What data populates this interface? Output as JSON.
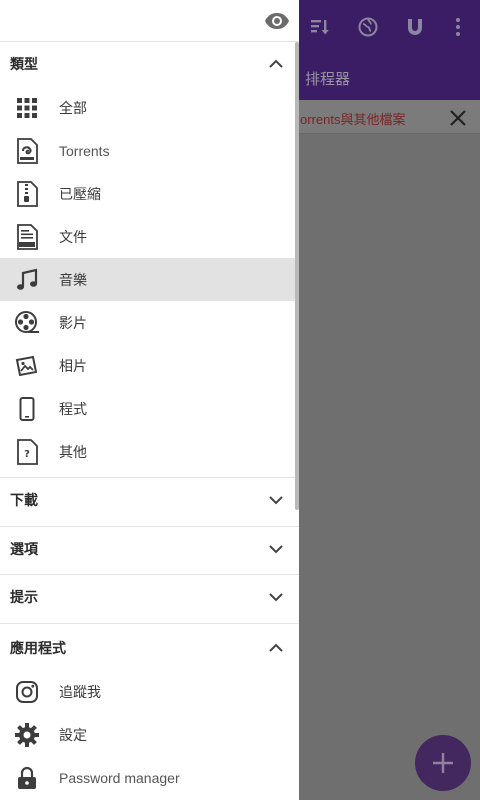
{
  "background_app": {
    "subtitle": "排程器",
    "notice_text": "orrents與其他檔案",
    "colors": {
      "app_bar": "#3a1d64",
      "notice_text": "#7d2323"
    }
  },
  "drawer": {
    "sections": {
      "types": {
        "title": "類型",
        "expanded": true
      },
      "download": {
        "title": "下載",
        "expanded": false
      },
      "options": {
        "title": "選項",
        "expanded": false
      },
      "tips": {
        "title": "提示",
        "expanded": false
      },
      "app": {
        "title": "應用程式",
        "expanded": true
      }
    },
    "type_items": [
      {
        "label": "全部",
        "icon": "grid-icon"
      },
      {
        "label": "Torrents",
        "icon": "torrent-file-icon"
      },
      {
        "label": "已壓縮",
        "icon": "zip-file-icon"
      },
      {
        "label": "文件",
        "icon": "doc-file-icon"
      },
      {
        "label": "音樂",
        "icon": "music-note-icon",
        "active": true
      },
      {
        "label": "影片",
        "icon": "film-reel-icon"
      },
      {
        "label": "相片",
        "icon": "photos-icon"
      },
      {
        "label": "程式",
        "icon": "phone-icon"
      },
      {
        "label": "其他",
        "icon": "unknown-file-icon"
      }
    ],
    "app_items": [
      {
        "label": "追蹤我",
        "icon": "instagram-icon"
      },
      {
        "label": "設定",
        "icon": "gear-icon"
      },
      {
        "label": "Password manager",
        "icon": "lock-icon"
      }
    ],
    "colors": {
      "active_bg": "#e2e2e2",
      "icon": "#3d3d3d"
    }
  }
}
